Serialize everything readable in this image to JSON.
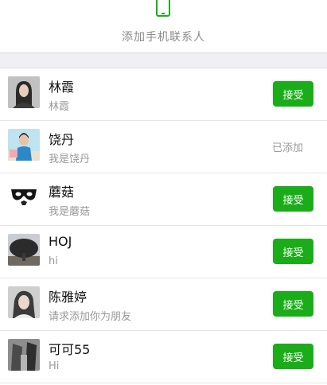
{
  "header": {
    "icon": "phone-icon",
    "label": "添加手机联系人",
    "accent": "#1aad19"
  },
  "requests": [
    {
      "name": "林霞",
      "message": "林霞",
      "action": "接受",
      "avatar": "portrait-avatar"
    },
    {
      "name": "饶丹",
      "message": "我是饶丹",
      "status": "已添加",
      "avatar": "portrait-avatar"
    },
    {
      "name": "蘑菇",
      "message": "我是蘑菇",
      "action": "接受",
      "avatar": "mask-avatar"
    },
    {
      "name": "HOJ",
      "message": "hi",
      "action": "接受",
      "avatar": "tree-avatar"
    },
    {
      "name": "陈雅婷",
      "message": "请求添加你为朋友",
      "action": "接受",
      "avatar": "portrait-avatar"
    },
    {
      "name": "可可55",
      "message": "Hi",
      "action": "接受",
      "avatar": "building-avatar"
    }
  ],
  "colors": {
    "accent_green": "#1aad19",
    "secondary_text": "#999999",
    "separator_bg": "#efeff4"
  }
}
